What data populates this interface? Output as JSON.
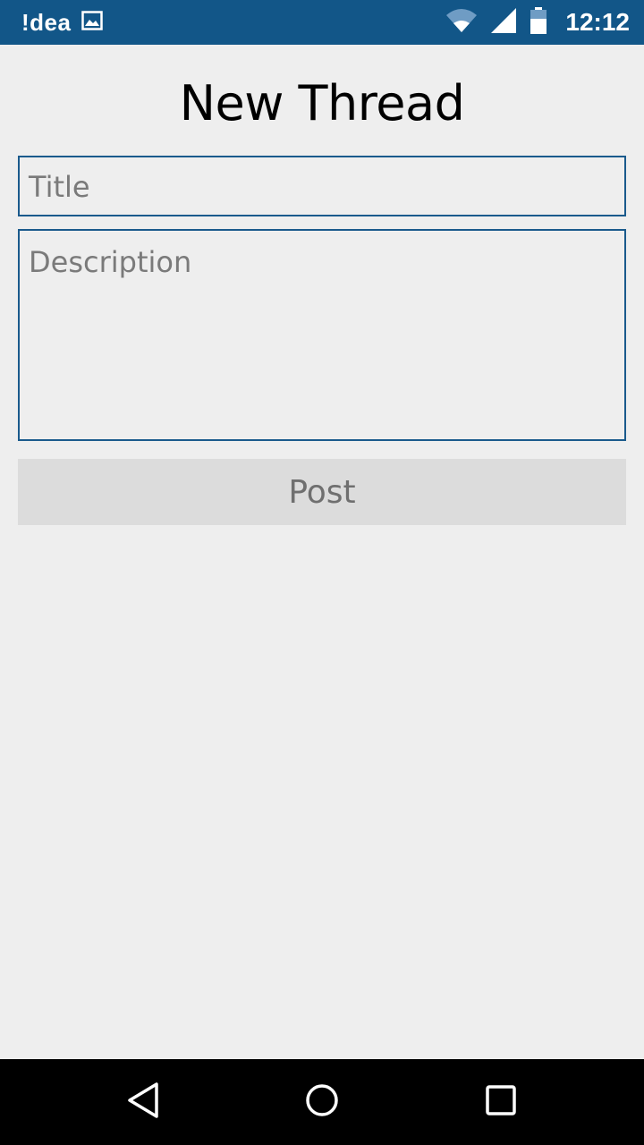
{
  "status_bar": {
    "carrier": "!dea",
    "time": "12:12",
    "icons": [
      "image-notification-icon",
      "wifi-icon",
      "signal-icon",
      "battery-icon"
    ],
    "color": "#125688"
  },
  "page": {
    "title": "New Thread"
  },
  "form": {
    "title_placeholder": "Title",
    "description_placeholder": "Description",
    "post_label": "Post"
  },
  "nav_bar": {
    "icons": [
      "back-icon",
      "home-icon",
      "recents-icon"
    ]
  }
}
